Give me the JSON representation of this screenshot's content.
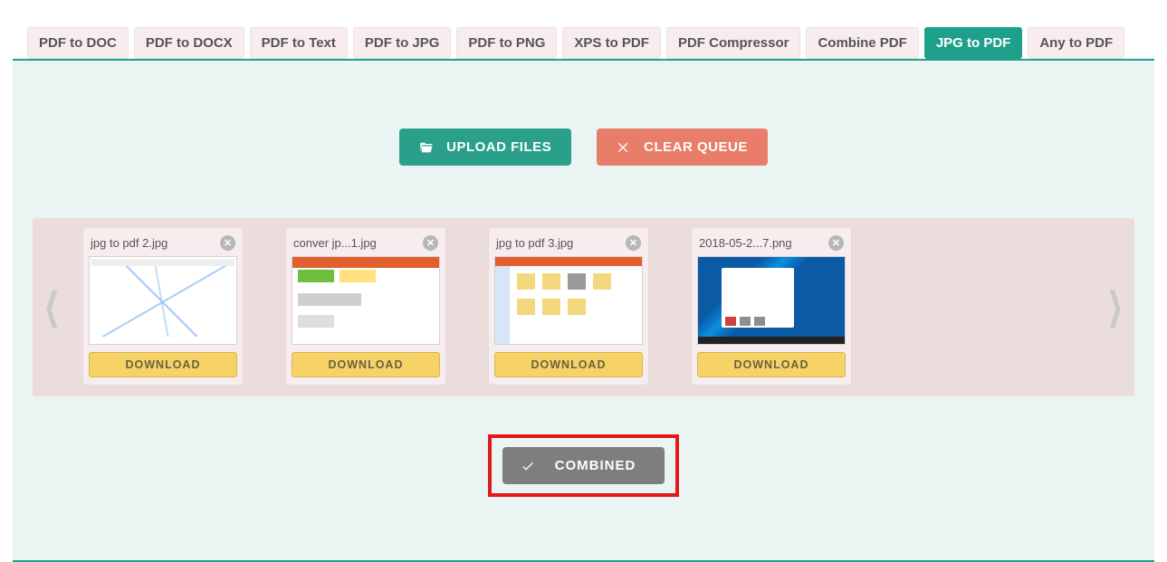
{
  "tabs": [
    {
      "label": "PDF to DOC",
      "active": false
    },
    {
      "label": "PDF to DOCX",
      "active": false
    },
    {
      "label": "PDF to Text",
      "active": false
    },
    {
      "label": "PDF to JPG",
      "active": false
    },
    {
      "label": "PDF to PNG",
      "active": false
    },
    {
      "label": "XPS to PDF",
      "active": false
    },
    {
      "label": "PDF Compressor",
      "active": false
    },
    {
      "label": "Combine PDF",
      "active": false
    },
    {
      "label": "JPG to PDF",
      "active": true
    },
    {
      "label": "Any to PDF",
      "active": false
    }
  ],
  "actions": {
    "upload_label": "UPLOAD FILES",
    "clear_label": "CLEAR QUEUE"
  },
  "files": [
    {
      "name": "jpg to pdf 2.jpg",
      "variant": "v1",
      "download_label": "DOWNLOAD"
    },
    {
      "name": "conver jp...1.jpg",
      "variant": "v2",
      "download_label": "DOWNLOAD"
    },
    {
      "name": "jpg to pdf 3.jpg",
      "variant": "v3",
      "download_label": "DOWNLOAD"
    },
    {
      "name": "2018-05-2...7.png",
      "variant": "v4",
      "download_label": "DOWNLOAD"
    }
  ],
  "combined_label": "COMBINED"
}
